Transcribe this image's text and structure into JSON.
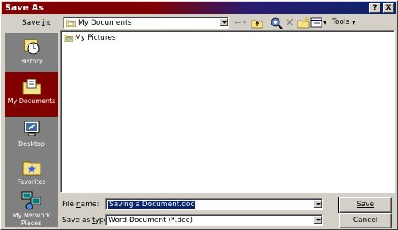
{
  "title": "Save As",
  "titlebar": {
    "help": "?",
    "close": "X"
  },
  "save_in": {
    "label_pre": "Save ",
    "label_key": "i",
    "label_post": "n:",
    "value": "My Documents"
  },
  "toolbar": {
    "tools_label": "Tools"
  },
  "places": [
    {
      "label": "History",
      "icon": "history-icon"
    },
    {
      "label": "My Documents",
      "icon": "my-documents-icon"
    },
    {
      "label": "Desktop",
      "icon": "desktop-icon"
    },
    {
      "label": "Favorites",
      "icon": "favorites-icon"
    },
    {
      "label": "My Network Places",
      "icon": "network-places-icon"
    }
  ],
  "files": [
    {
      "name": "My Pictures",
      "icon": "folder-icon"
    }
  ],
  "file_name": {
    "label_pre": "File ",
    "label_key": "n",
    "label_post": "ame:",
    "value": "Saving a Document.doc"
  },
  "save_as_type": {
    "label_pre": "Save as ",
    "label_key": "t",
    "label_post": "ype:",
    "value": "Word Document (*.doc)"
  },
  "buttons": {
    "save": "Save",
    "cancel": "Cancel"
  },
  "colors": {
    "title_left": "#800000",
    "title_right": "#0a246a",
    "places_bg": "#808080",
    "selected_place": "#800000"
  }
}
